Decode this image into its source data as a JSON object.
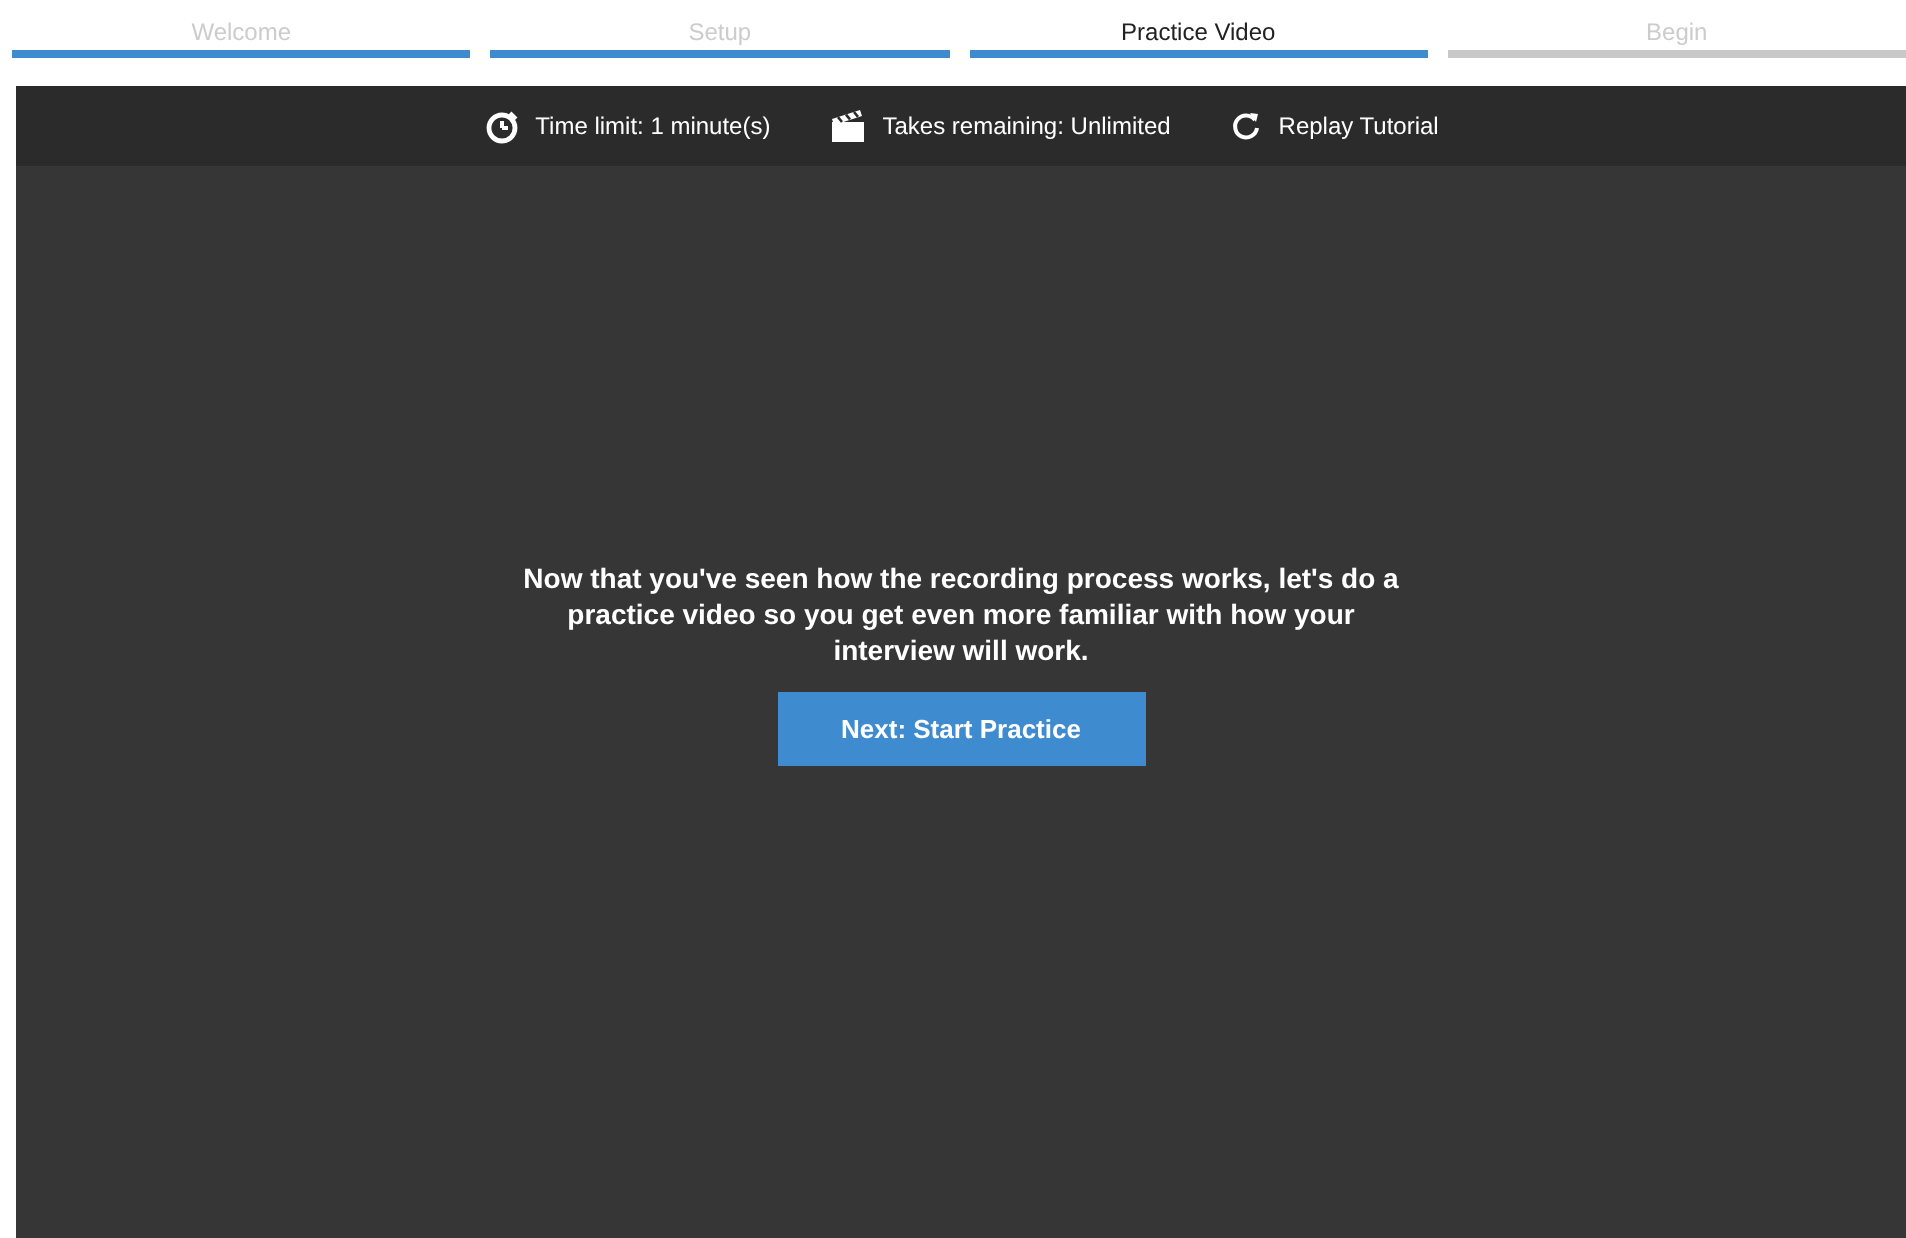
{
  "steps": [
    {
      "label": "Welcome",
      "selected": false,
      "completed": true
    },
    {
      "label": "Setup",
      "selected": false,
      "completed": true
    },
    {
      "label": "Practice Video",
      "selected": true,
      "completed": true
    },
    {
      "label": "Begin",
      "selected": false,
      "completed": false
    }
  ],
  "info_bar": [
    {
      "kind": "timer",
      "text": "Time limit: 1 minute(s)"
    },
    {
      "kind": "takes",
      "text": "Takes remaining: Unlimited"
    },
    {
      "kind": "replay",
      "text": "Replay Tutorial"
    }
  ],
  "message": "Now that you've seen how the recording process works, let's do a practice video so you get even more familiar with how your interview will work.",
  "button": "Next: Start Practice"
}
